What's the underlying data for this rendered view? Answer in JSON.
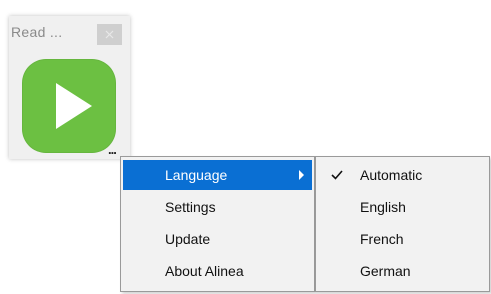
{
  "widget": {
    "title": "Read ...",
    "close_icon": "close-icon",
    "play_icon": "play-icon",
    "more_label": "...",
    "tile_color": "#6cc042"
  },
  "menu": {
    "items": [
      {
        "label": "Language",
        "has_submenu": true,
        "highlighted": true
      },
      {
        "label": "Settings"
      },
      {
        "label": "Update"
      },
      {
        "label": "About Alinea"
      }
    ]
  },
  "language_submenu": {
    "items": [
      {
        "label": "Automatic",
        "checked": true
      },
      {
        "label": "English"
      },
      {
        "label": "French"
      },
      {
        "label": "German"
      }
    ]
  },
  "colors": {
    "highlight": "#0a6fd3",
    "menu_bg": "#f2f2f2"
  }
}
